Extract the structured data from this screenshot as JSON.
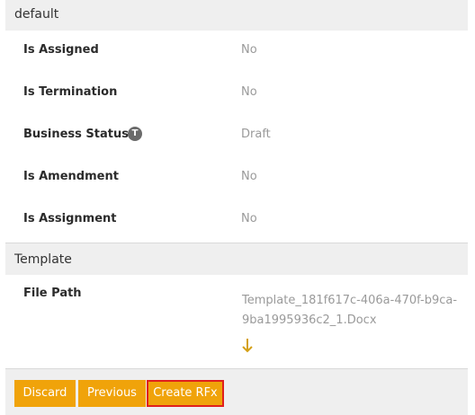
{
  "sections": {
    "default": {
      "title": "default",
      "fields": [
        {
          "label": "Is Assigned",
          "value": "No"
        },
        {
          "label": "Is Termination",
          "value": "No"
        },
        {
          "label": "Business Status",
          "value": "Draft",
          "badge": "T"
        },
        {
          "label": "Is Amendment",
          "value": "No"
        },
        {
          "label": "Is Assignment",
          "value": "No"
        }
      ]
    },
    "template": {
      "title": "Template",
      "file_path_label": "File Path",
      "file_path_value": "Template_181f617c-406a-470f-b9ca-9ba1995936c2_1.Docx",
      "download_icon": "download-arrow-icon"
    }
  },
  "footer": {
    "discard_label": "Discard",
    "previous_label": "Previous",
    "create_label": "Create RFx"
  },
  "colors": {
    "accent": "#f0a30a",
    "highlight_border": "#e0201c",
    "header_bg": "#efefef",
    "value_text": "#9a9a9a"
  }
}
